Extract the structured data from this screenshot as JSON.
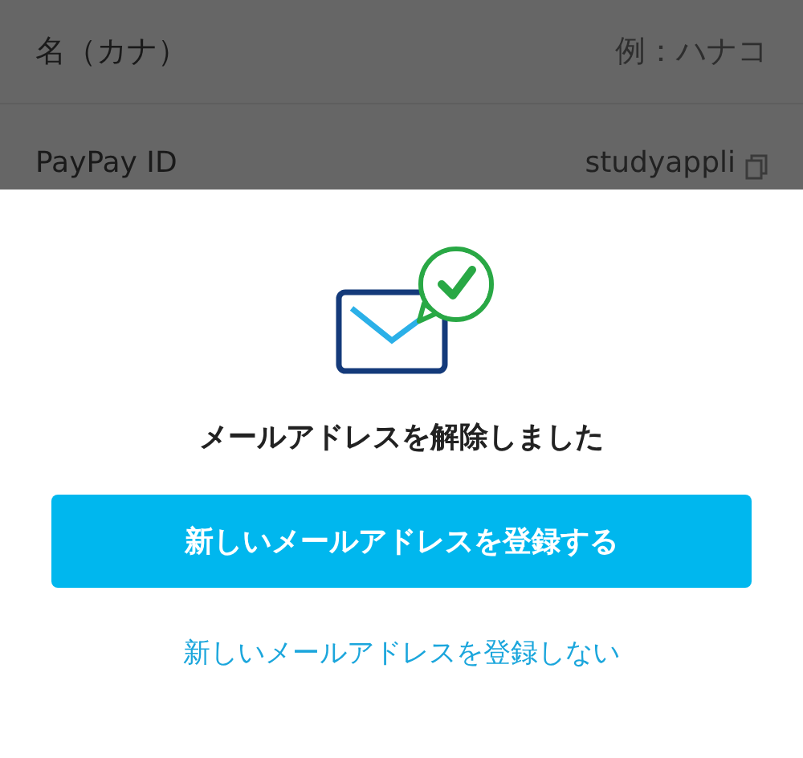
{
  "form_rows": [
    {
      "label": "名（カナ）",
      "placeholder": "例：ハナコ"
    },
    {
      "label": "PayPay ID",
      "value": "studyappli"
    }
  ],
  "sheet": {
    "message": "メールアドレスを解除しました",
    "primary_button": "新しいメールアドレスを登録する",
    "secondary_link": "新しいメールアドレスを登録しない"
  }
}
